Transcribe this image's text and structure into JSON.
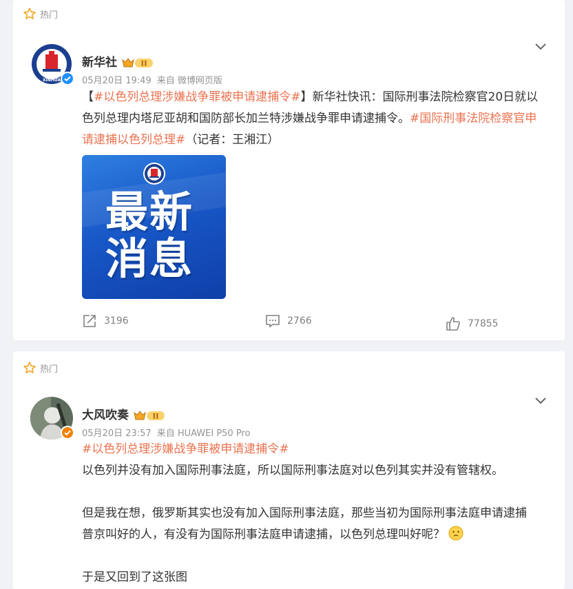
{
  "posts": [
    {
      "hot_label": "热门",
      "author": "新华社",
      "time": "05月20日 19:49",
      "source": "来自 微博网页版",
      "text_parts": [
        "【",
        "#以色列总理涉嫌战争罪被申请逮捕令#",
        "】新华社快讯：国际刑事法院检察官20日就以",
        "色列总理内塔尼亚胡和国防部长加兰特涉嫌战争罪申请逮捕令。",
        "#国际刑事法院检察官申",
        "请逮捕以色列总理#",
        "（记者：王湘江）"
      ],
      "image_text": [
        "最新",
        "消息"
      ],
      "avatar_text": "XINHUA",
      "repost_count": "3196",
      "comment_count": "2766",
      "like_count": "77855"
    },
    {
      "hot_label": "热门",
      "author": "大风吹奏",
      "time": "05月20日 23:57",
      "source": "来自 HUAWEI P50 Pro",
      "tag": "#以色列总理涉嫌战争罪被申请逮捕令#",
      "para1": "以色列并没有加入国际刑事法庭，所以国际刑事法庭对以色列其实并没有管辖权。",
      "para2_line1": "但是我在想，俄罗斯其实也没有加入国际刑事法庭，那些当初为国际刑事法庭申请逮捕",
      "para2_line2": "普京叫好的人，有没有为国际刑事法庭申请逮捕，以色列总理叫好呢？",
      "para3": "于是又回到了这张图"
    }
  ],
  "colors": {
    "tag": "#eb7350",
    "meta": "#939393",
    "verified_blue": "#1e90ff",
    "verified_orange": "#f08200"
  }
}
